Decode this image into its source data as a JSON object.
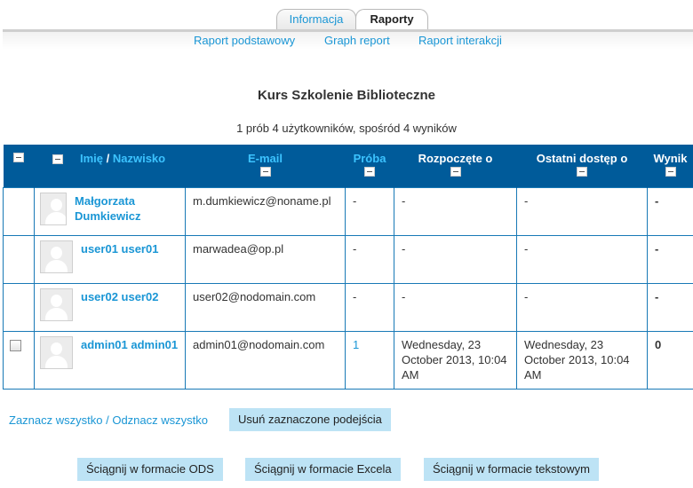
{
  "tabs": [
    {
      "label": "Informacja",
      "active": false
    },
    {
      "label": "Raporty",
      "active": true
    }
  ],
  "subtabs": [
    "Raport podstawowy",
    "Graph report",
    "Raport interakcji"
  ],
  "course_title": "Kurs Szkolenie Biblioteczne",
  "summary": "1 prób 4 użytkowników, spośród 4 wyników",
  "table": {
    "headers": {
      "name_first": "Imię",
      "name_sep": " / ",
      "name_last": "Nazwisko",
      "email": "E-mail",
      "attempt": "Próba",
      "started": "Rozpoczęte o",
      "last_access": "Ostatni dostęp o",
      "score": "Wynik"
    },
    "rows": [
      {
        "has_checkbox": false,
        "name": "Małgorzata Dumkiewicz",
        "email": "m.dumkiewicz@noname.pl",
        "attempt": "-",
        "started": "-",
        "last_access": "-",
        "score": "-"
      },
      {
        "has_checkbox": false,
        "name": "user01 user01",
        "email": "marwadea@op.pl",
        "attempt": "-",
        "started": "-",
        "last_access": "-",
        "score": "-"
      },
      {
        "has_checkbox": false,
        "name": "user02 user02",
        "email": "user02@nodomain.com",
        "attempt": "-",
        "started": "-",
        "last_access": "-",
        "score": "-"
      },
      {
        "has_checkbox": true,
        "name": "admin01 admin01",
        "email": "admin01@nodomain.com",
        "attempt": "1",
        "started": "Wednesday, 23 October 2013, 10:04 AM",
        "last_access": "Wednesday, 23 October 2013, 10:04 AM",
        "score": "0"
      }
    ]
  },
  "select_links": {
    "select_all": "Zaznacz wszystko",
    "sep": " / ",
    "deselect_all": "Odznacz wszystko"
  },
  "buttons": {
    "delete_selected": "Usuń zaznaczone podejścia",
    "download_ods": "Ściągnij w formacie ODS",
    "download_excel": "Ściągnij w formacie Excela",
    "download_text": "Ściągnij w formacie tekstowym"
  },
  "colors": {
    "header_bg": "#005b9a",
    "link": "#1a96d5",
    "button_bg": "#bde3f5"
  }
}
